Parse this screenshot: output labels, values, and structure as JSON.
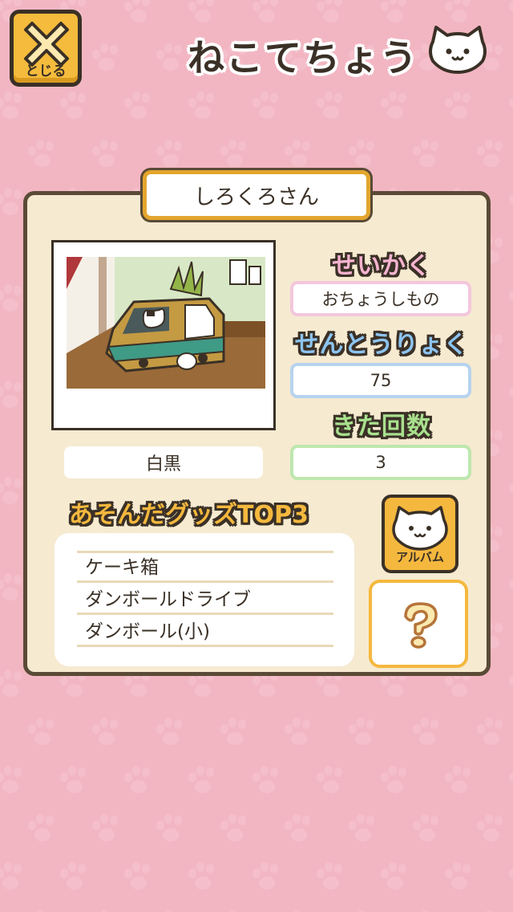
{
  "header": {
    "close_label": "とじる",
    "title": "ねこてちょう"
  },
  "cat": {
    "name": "しろくろさん",
    "color": "白黒",
    "personality_label": "せいかく",
    "personality": "おちょうしもの",
    "power_label": "せんとうりょく",
    "power": "75",
    "visits_label": "きた回数",
    "visits": "3"
  },
  "goods": {
    "heading": "あそんだグッズTOP3",
    "items": [
      "ケーキ箱",
      "ダンボールドライブ",
      "ダンボール(小)"
    ]
  },
  "album": {
    "label": "アルバム"
  },
  "colors": {
    "background": "#f2b6c2",
    "panel": "#f6ead1",
    "accent_orange": "#f5b83e",
    "outline": "#3a3026"
  },
  "icons": [
    "close-icon",
    "cat-face-icon",
    "photo",
    "question-icon"
  ]
}
